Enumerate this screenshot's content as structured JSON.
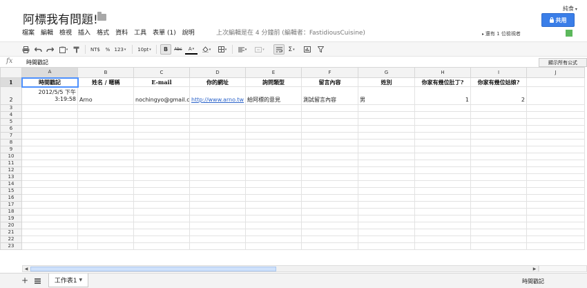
{
  "header": {
    "title": "阿標我有問題!",
    "user": "純食",
    "share_label": "共用",
    "last_edit": "上次編輯是在 4 分鐘前 (編輯者：FastidiousCuisine)",
    "viewer_note": "還有 1 位檢視者"
  },
  "menu": [
    "檔案",
    "編輯",
    "檢視",
    "插入",
    "格式",
    "資料",
    "工具",
    "表單 (1)",
    "說明"
  ],
  "toolbar": {
    "currency": "NT$",
    "percent": "%",
    "format_123": "123",
    "font_size": "10pt",
    "bold": "B",
    "abc": "Abc",
    "text_color": "A",
    "sigma": "Σ"
  },
  "formula_bar": {
    "fx": "fx",
    "content": "時間戳記",
    "show_formulas": "顯示所有公式"
  },
  "sheet": {
    "columns": [
      "A",
      "B",
      "C",
      "D",
      "E",
      "F",
      "G",
      "H",
      "I",
      "J"
    ],
    "headers": [
      "時間戳記",
      "姓名 / 暱稱",
      "E-mail",
      "你的網址",
      "詢問類型",
      "留言內容",
      "姓別",
      "你家有幾位肚丁?",
      "你家有幾位姑娘?",
      ""
    ],
    "row2": {
      "date": "2012/5/5 下午",
      "time": "3:19:58",
      "name": "Arno",
      "email": "nochingyo@gmail.com",
      "url": "http://www.arno.tw",
      "type": "給阿標的意見",
      "message": "測試留言內容",
      "gender": "男",
      "q1": "1",
      "q2": "2",
      "j": ""
    },
    "row_numbers": [
      "1",
      "2",
      "3",
      "4",
      "5",
      "6",
      "7",
      "8",
      "9",
      "10",
      "11",
      "12",
      "13",
      "14",
      "15",
      "16",
      "17",
      "18",
      "19",
      "20",
      "21",
      "22",
      "23"
    ]
  },
  "bottom": {
    "add_sheet": "+",
    "sheet_tab": "工作表1",
    "status": "時間戳記"
  }
}
